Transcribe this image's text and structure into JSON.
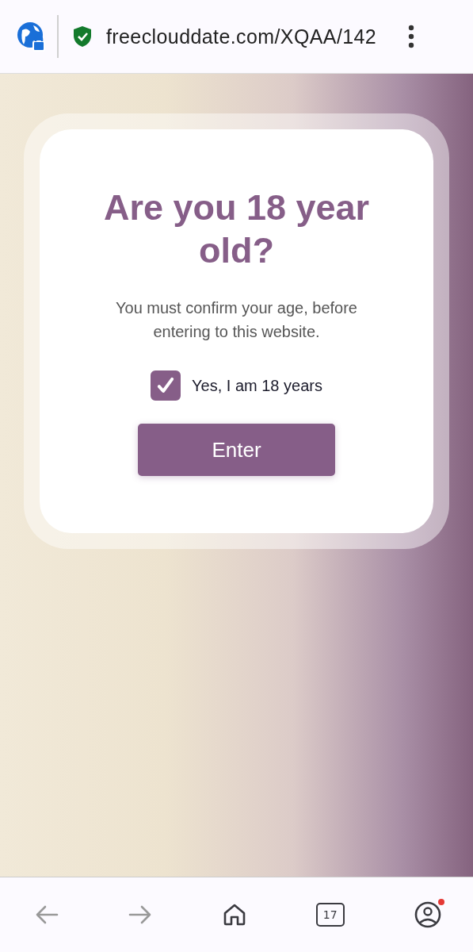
{
  "address_bar": {
    "url": "freeclouddate.com/XQAA/142"
  },
  "dialog": {
    "title": "Are you 18 year old?",
    "message": "You must confirm your age, before entering to this website.",
    "confirm": {
      "label": "Yes, I am 18 years",
      "checked": true
    },
    "button": "Enter"
  },
  "bottom_bar": {
    "back_disabled": true,
    "forward_disabled": true,
    "tab_count": "17",
    "profile_notification": true
  }
}
